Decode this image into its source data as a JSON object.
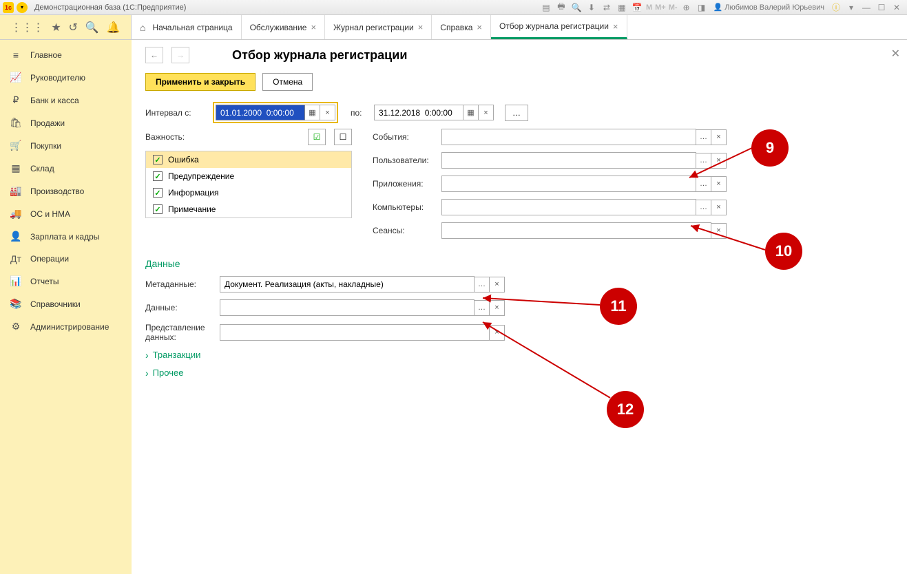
{
  "titlebar": {
    "title": "Демонстрационная база  (1С:Предприятие)",
    "user": "Любимов Валерий Юрьевич",
    "mem": [
      "M",
      "M+",
      "M-"
    ]
  },
  "toolbar_tabs": [
    {
      "label": "Начальная страница",
      "home": true,
      "closable": false
    },
    {
      "label": "Обслуживание",
      "closable": true
    },
    {
      "label": "Журнал регистрации",
      "closable": true
    },
    {
      "label": "Справка",
      "closable": true
    },
    {
      "label": "Отбор журнала регистрации",
      "closable": true,
      "active": true
    }
  ],
  "sidebar": [
    {
      "icon": "≡",
      "label": "Главное"
    },
    {
      "icon": "📈",
      "label": "Руководителю"
    },
    {
      "icon": "₽",
      "label": "Банк и касса"
    },
    {
      "icon": "🛍",
      "label": "Продажи"
    },
    {
      "icon": "🛒",
      "label": "Покупки"
    },
    {
      "icon": "▦",
      "label": "Склад"
    },
    {
      "icon": "🏭",
      "label": "Производство"
    },
    {
      "icon": "🚚",
      "label": "ОС и НМА"
    },
    {
      "icon": "👤",
      "label": "Зарплата и кадры"
    },
    {
      "icon": "Дт",
      "label": "Операции"
    },
    {
      "icon": "📊",
      "label": "Отчеты"
    },
    {
      "icon": "📚",
      "label": "Справочники"
    },
    {
      "icon": "⚙",
      "label": "Администрирование"
    }
  ],
  "page": {
    "title": "Отбор журнала регистрации",
    "apply_btn": "Применить и закрыть",
    "cancel_btn": "Отмена",
    "interval_from_lbl": "Интервал с:",
    "interval_from_val": "01.01.2000  0:00:00",
    "interval_to_lbl": "по:",
    "interval_to_val": "31.12.2018  0:00:00",
    "importance_lbl": "Важность:",
    "importance_items": [
      "Ошибка",
      "Предупреждение",
      "Информация",
      "Примечание"
    ],
    "filters": {
      "events": "События:",
      "users": "Пользователи:",
      "apps": "Приложения:",
      "computers": "Компьютеры:",
      "sessions": "Сеансы:"
    },
    "data_section": "Данные",
    "metadata_lbl": "Метаданные:",
    "metadata_val": "Документ. Реализация (акты, накладные)",
    "data_lbl": "Данные:",
    "repr_lbl": "Представление данных:",
    "transactions": "Транзакции",
    "other": "Прочее"
  },
  "callouts": {
    "c9": "9",
    "c10": "10",
    "c11": "11",
    "c12": "12"
  }
}
